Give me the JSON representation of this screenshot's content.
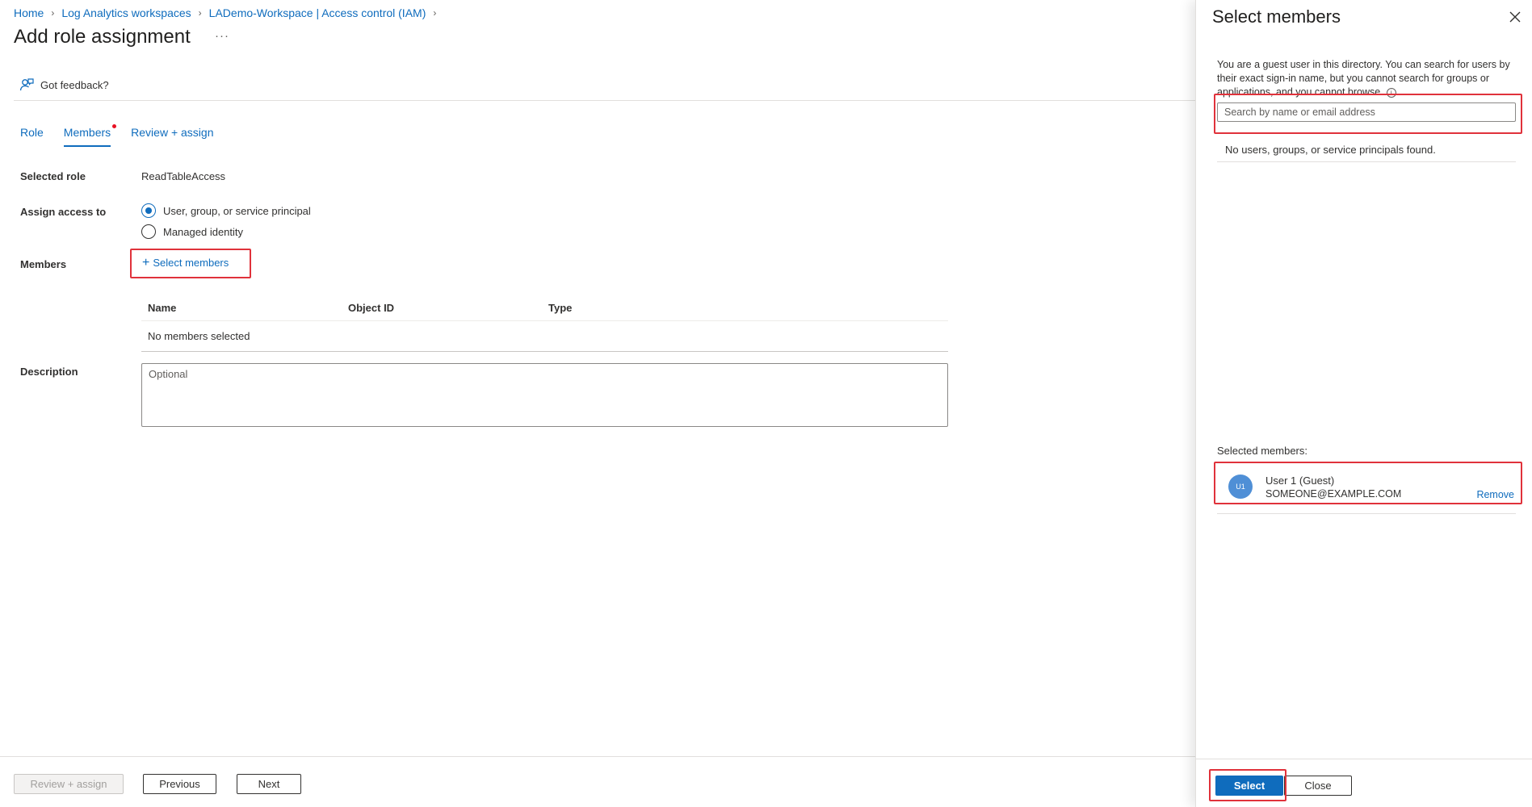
{
  "breadcrumb": {
    "items": [
      "Home",
      "Log Analytics workspaces",
      "LADemo-Workspace | Access control (IAM)"
    ]
  },
  "page": {
    "title": "Add role assignment",
    "more": "···"
  },
  "feedback": {
    "label": "Got feedback?"
  },
  "tabs": {
    "role": "Role",
    "members": "Members",
    "review": "Review + assign"
  },
  "form": {
    "selected_role_label": "Selected role",
    "selected_role_value": "ReadTableAccess",
    "assign_access_label": "Assign access to",
    "assign_options": [
      "User, group, or service principal",
      "Managed identity"
    ],
    "members_label": "Members",
    "select_members_link": "Select members",
    "table": {
      "columns": [
        "Name",
        "Object ID",
        "Type"
      ],
      "empty_text": "No members selected"
    },
    "description_label": "Description",
    "description_placeholder": "Optional"
  },
  "footer": {
    "review_assign": "Review + assign",
    "previous": "Previous",
    "next": "Next"
  },
  "panel": {
    "title": "Select members",
    "guest_note": "You are a guest user in this directory. You can search for users by their exact sign-in name, but you cannot search for groups or applications, and you cannot browse.",
    "search_placeholder": "Search by name or email address",
    "no_results": "No users, groups, or service principals found.",
    "selected_members_label": "Selected members:",
    "selected": [
      {
        "initials": "U1",
        "name": "User 1 (Guest)",
        "email": "SOMEONE@EXAMPLE.COM",
        "remove": "Remove"
      }
    ],
    "select_button": "Select",
    "close_button": "Close"
  },
  "colors": {
    "accent": "#0f6cbd",
    "highlight_box": "#e0323b",
    "avatar": "#4f8fd6",
    "required_dot": "#e81123"
  }
}
